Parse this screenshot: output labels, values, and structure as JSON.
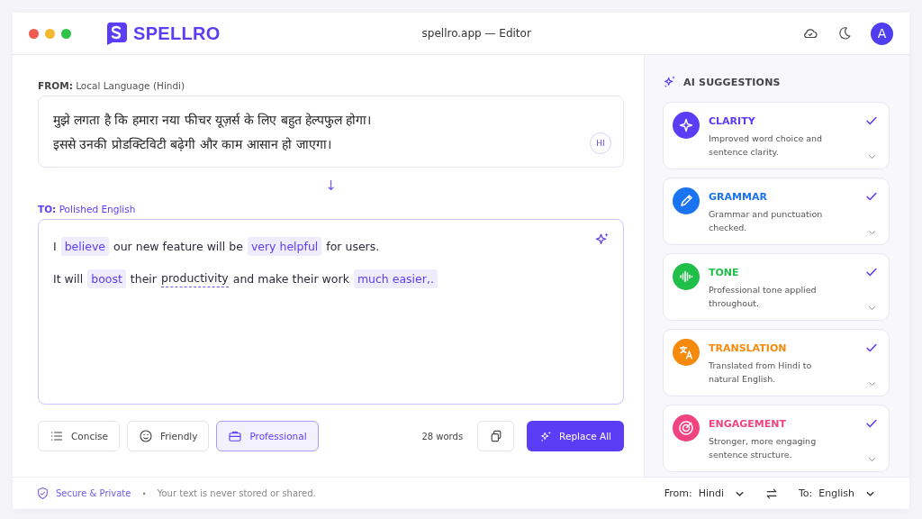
{
  "window": {
    "brand": "SPELLRO",
    "title": "spellro.app — Editor",
    "avatar": "A"
  },
  "source": {
    "label_prefix": "FROM:",
    "label": "Local Language (Hindi)",
    "lines": [
      "मुझे लगता है कि हमारा नया फीचर यूज़र्स के लिए बहुत हेल्पफुल होगा।",
      "इससे उनकी प्रोडक्टिविटी बढ़ेगी और काम आसान हो जाएगा।"
    ],
    "badge": "HI"
  },
  "arrow": "↓",
  "target": {
    "label_prefix": "TO:",
    "label": "Polished English",
    "lines": [
      [
        {
          "kind": "plain",
          "text": "I"
        },
        {
          "kind": "highlight",
          "text": "believe"
        },
        {
          "kind": "plain",
          "text": "our new feature will be"
        },
        {
          "kind": "highlight",
          "text": "very helpful"
        },
        {
          "kind": "plain",
          "text": "for users."
        }
      ],
      [
        {
          "kind": "plain",
          "text": "It will"
        },
        {
          "kind": "highlight",
          "text": "boost"
        },
        {
          "kind": "plain",
          "text": "their"
        },
        {
          "kind": "underline",
          "text": "productivity"
        },
        {
          "kind": "plain",
          "text": "and make their work"
        },
        {
          "kind": "highlight",
          "text": "much easier,."
        }
      ]
    ]
  },
  "tones": [
    {
      "kind": "list",
      "label": "Concise",
      "selected": false
    },
    {
      "kind": "smile",
      "label": "Friendly",
      "selected": false
    },
    {
      "kind": "briefcase",
      "label": "Professional",
      "selected": true
    }
  ],
  "word_count": "28 words",
  "replace_button": "Replace All",
  "suggestions": {
    "title": "AI SUGGESTIONS",
    "items": [
      {
        "kind": "sparkle",
        "title": "CLARITY",
        "text": "Improved word choice and sentence clarity.",
        "color": "#5b3df5",
        "checked": true
      },
      {
        "kind": "pencil",
        "title": "GRAMMAR",
        "text": "Grammar and punctuation checked.",
        "color": "#1a73f0",
        "checked": true
      },
      {
        "kind": "wave",
        "title": "TONE",
        "text": "Professional tone applied throughout.",
        "color": "#1fbf4a",
        "checked": true
      },
      {
        "kind": "translate",
        "title": "TRANSLATION",
        "text": "Translated from Hindi to natural English.",
        "color": "#f58a0c",
        "checked": true
      },
      {
        "kind": "target",
        "title": "ENGAGEMENT",
        "text": "Stronger, more engaging sentence structure.",
        "color": "#f0437f",
        "checked": true
      }
    ]
  },
  "footer": {
    "secure": "Secure & Private",
    "bullet": "•",
    "note": "Your text is never stored or shared.",
    "from_label": "From:",
    "from_value": "Hindi",
    "to_label": "To:",
    "to_value": "English"
  }
}
